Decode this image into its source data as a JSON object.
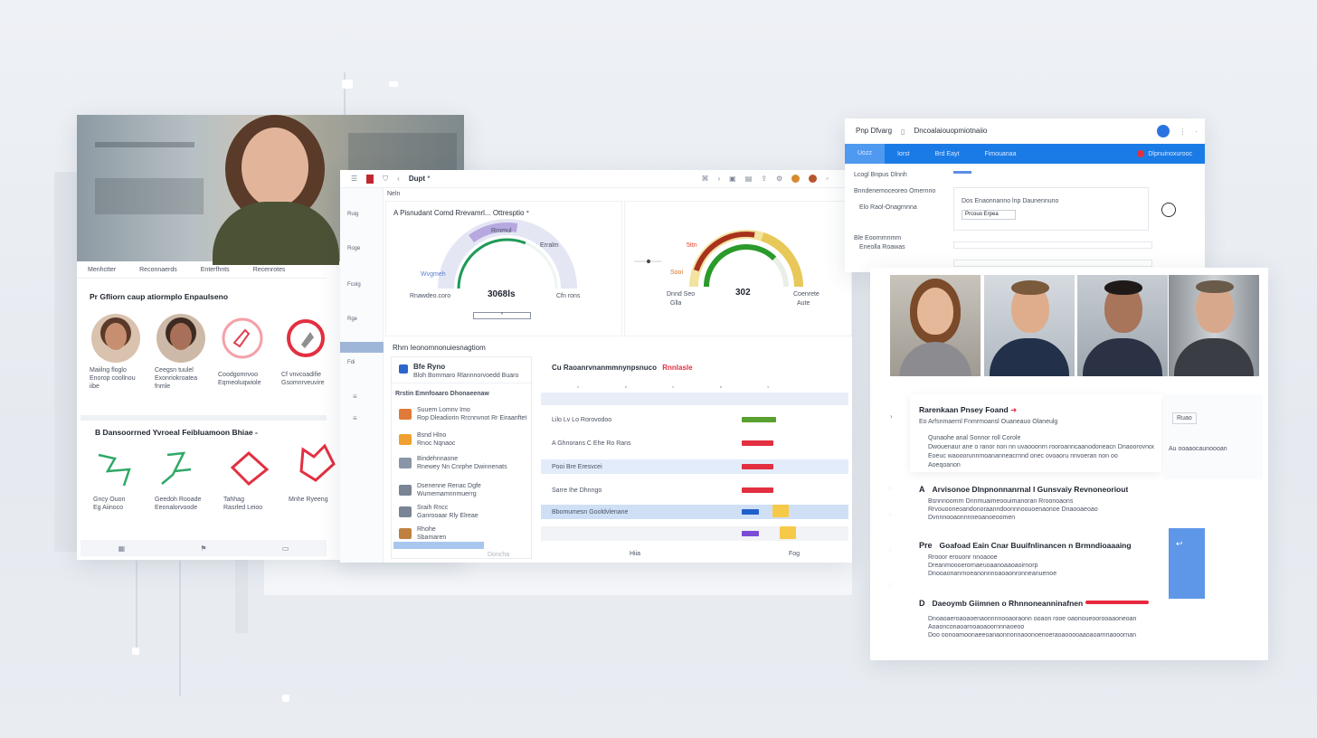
{
  "left": {
    "tabs": [
      "Menhctter",
      "Reconnaerds",
      "Enterfhnts",
      "Recenrotes"
    ],
    "section1_title": "Pr Gfliorn caup atiormplo Enpaulseno",
    "avatars": [
      {
        "name": "Maiilng floglo",
        "desc": "Enorop coollnou",
        "extra": "iibe",
        "color": "#b77a5a"
      },
      {
        "name": "Ceegsn tuulel",
        "desc": "Exonriokroatea",
        "extra": "fnmle",
        "color": "#8a5a45"
      },
      {
        "name": "Coodgomrvoo",
        "desc": "Eqmeoluqwiole",
        "extra": "",
        "color": "#e04050"
      },
      {
        "name": "Cf vnvcoadifie",
        "desc": "Gsomnrveuvire",
        "extra": "",
        "color": "#d83040"
      }
    ],
    "section2_title": "B Dansoorrned Yvroeal Feibluamoon Bhiae -",
    "scribbles": [
      {
        "label": "Gncy Ouon",
        "sub": "Eg Aiinoco",
        "color": "#2fa866"
      },
      {
        "label": "Geedoh Rooade",
        "sub": "Eeonalorvoode",
        "color": "#2fa866"
      },
      {
        "label": "Tahhag",
        "sub": "Rasrled Leioo",
        "color": "#e23040"
      },
      {
        "label": "Mnhe Ryeeng",
        "sub": "",
        "color": "#e23040"
      }
    ],
    "footer_icons": [
      "grid-icon",
      "flag-icon",
      "doc-icon"
    ]
  },
  "center": {
    "toolbar_title": "Dupt ᐤ",
    "toolbar_icons": [
      "menu-icon",
      "pdf-icon",
      "filter-icon",
      "back-icon",
      "link-icon",
      "forward-icon",
      "image-icon",
      "chart-icon",
      "share-icon",
      "settings-icon",
      "user-icon",
      "bell-icon"
    ],
    "breadcrumb": "Neln",
    "sidebar": [
      "Ruig",
      "Roge",
      "Fcolg",
      "Rge",
      "Fdi"
    ],
    "gauge1": {
      "title": "A Pisnudant Comd Rrevamrl... Ottresptio ᐤ",
      "value": "3068ls",
      "left_label": "Wvgmeh",
      "top_label": "Rrnmul",
      "right_label": "Erralm",
      "foot_left": "Rnawdeo.coro",
      "foot_right": "Cfn rons",
      "input_value": "ᐤ",
      "level": 0.62
    },
    "gauge2": {
      "value": "302",
      "left_top": "5ttn",
      "left_mid": "Sooi",
      "right_label": "Coenrete",
      "foot_left": "Dnnd Seo",
      "foot_right": "Aute",
      "side_left": "Glla",
      "level": 0.55
    },
    "list_header": "Rhrn Ieonomnonuiesnagtiom",
    "list_title": "Bfe Ryno",
    "list_subtitle": "Bloh Bommaro Rlannnorvoedd Buaro",
    "list_group": "Rrstin Emnfoaaro Dhonaeenaw",
    "list_items": [
      {
        "t": "Suuem Lomnv Imo",
        "s": "Rop Dleadiorin Rrcnnvnot Rr Eiraanftet",
        "c": "#e07a3a"
      },
      {
        "t": "Bsnd Hlno",
        "s": "Rnoc Nqnaoc",
        "c": "#f0a030"
      },
      {
        "t": "Bindehnnaone",
        "s": "Rnewey Nn Cnrphe Dwinnenats",
        "c": "#8896a8"
      },
      {
        "t": "Dsenenne Renac Dgfe",
        "s": "Wumemamnnmuerrg",
        "c": "#7a8494"
      },
      {
        "t": "Sraih Rncc",
        "s": "Ganrooaar Rly Elreae",
        "c": "#7a8494"
      },
      {
        "t": "Rhohe",
        "s": "Sbamaren",
        "c": "#c08040"
      }
    ],
    "list_button": "Doncha",
    "table_title": "Cu Raoanrvnanmmnynpsnuco",
    "table_badge": "Rnnlasle",
    "table_rows": [
      {
        "label": "Lilo Lv Lo Rorovodoo",
        "color": "#58a030",
        "fill": 0.6
      },
      {
        "label": "A Ghnorans C Ehe Ro Rans",
        "color": "#e23040",
        "fill": 0.55
      },
      {
        "label": "Pooi Bre Eresvcei",
        "color": "#e23040",
        "fill": 0.55
      },
      {
        "label": "Sarre Ihe Dhnngo",
        "color": "#e23040",
        "fill": 0.55
      },
      {
        "label": "Bbomumesn Gooldvlenane",
        "color": "#1f5fcc",
        "fill": 0.3
      },
      {
        "label": "",
        "color": "#7b4cd8",
        "fill": 0.3
      }
    ],
    "table_footer_left": "Hiia",
    "table_footer_right": "Fog"
  },
  "rtop": {
    "title": "Pnp Dfvarg",
    "subtitle": "Dncoalaiouopmiotnaiio",
    "nav": [
      "Uozz",
      "Iorst",
      "Brd Eayt",
      "Fimouanaa"
    ],
    "alert": "Dlpnuinoxurooc",
    "left_items": [
      "Lcogl Bnpus Dlnnh",
      "Bnndenemoceoreo Omernno",
      "Elo Raol-Onagrnnna",
      "Ble Eoornmnmm",
      "Eneolla Roawas"
    ],
    "field_label": "Dos Enaonnanno lnp Daunennuno",
    "field_value": "Prcouo Erpea"
  },
  "rbottom": {
    "card_title": "Rarenkaan Pnsey Foand",
    "card_sub": "Eo Arfsnmaernl Fnmrmoansl Ouaneauo Olaneulg",
    "card_lines": [
      "Qunaohe anal Sonnor roll Corole",
      "Dwouenaur ane o ranor non nn uvaooonrn rooroanncaanodoneacn Dnaoorovnooon",
      "Eoeuc waooorunnmoananneacrnnd onec ovoaoru nnvoeran non oo",
      "Aoeqoanon"
    ],
    "side_label": "Ruao",
    "side_text": "Au ooaaocaunoooan",
    "steps": [
      {
        "num": "A",
        "title": "Arvisonoe Dlnpnonnanrnal I Gunsvaiy Revnoneoriout",
        "lines": [
          "Bsnnnoomrn Dnnmuaimeoouimanoran Rroonoaons",
          "Rrvouooneoandonoraanndoonnnoouoenaonoe Dnaooaeoao",
          "Dvnnnooaonnnneoanoeoomen"
        ]
      },
      {
        "num": "Pre",
        "title": "Goafoad Eain Cnar Buuifnlinancen n Brmndioaaaing",
        "lines": [
          "Rrooor erouonr nnoaooe",
          "Dreanmoooerornaeuoaanoaaoaoirnorp",
          "Dnooaonanrnoeanonnnoaoaonronneanuenoe"
        ]
      },
      {
        "num": "D",
        "title": "Daeoymb Giimnen o Rhnnoneanninafnen",
        "lines": [
          "Dnoaoaeroaoaoenaonnnnooaoraonn ooaon rooe oaonoueoorooaaoneoanneooe",
          "Aoaonconaoarnoaoaoornnnaoeoo",
          "Doo oonoamoonaeeoanaonnonnaoonoenoeraoaooooaaoaoarnnaooornano"
        ]
      }
    ]
  }
}
